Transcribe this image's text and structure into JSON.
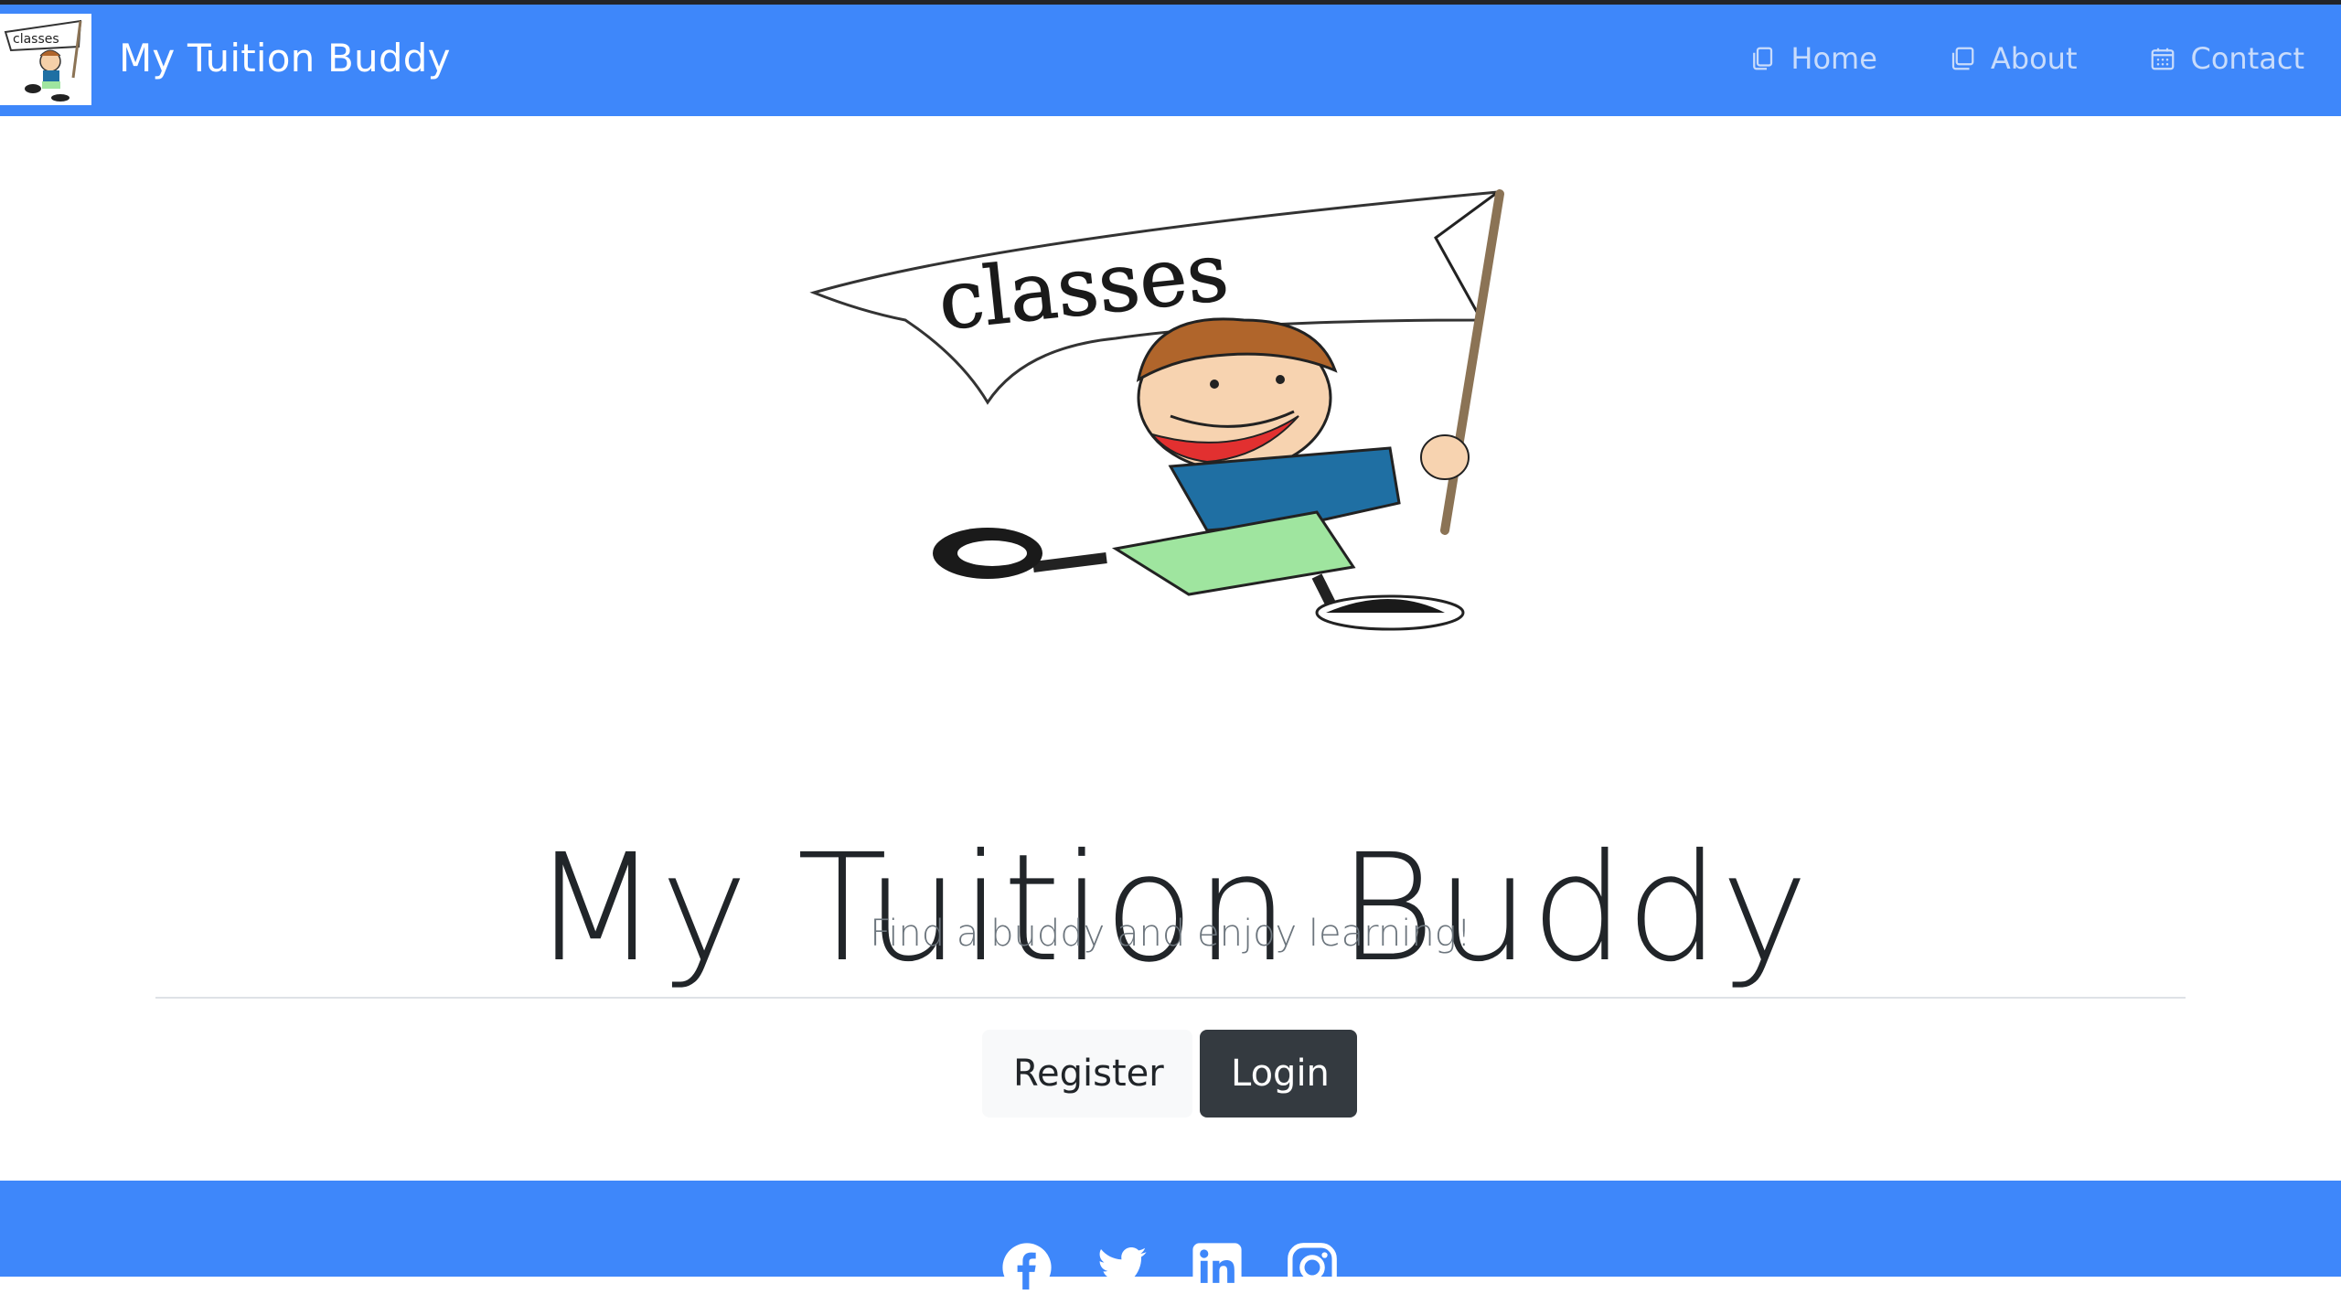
{
  "colors": {
    "primary": "#3e87fa",
    "nav_link": "#c9dcfb",
    "title": "#212529",
    "subtitle": "#6c757d",
    "light_button": "#f8f9fa",
    "dark_button": "#343a40"
  },
  "navbar": {
    "logo_icon": "classes-boy-logo",
    "brand": "My Tuition Buddy",
    "links": [
      {
        "label": "Home",
        "icon": "copy-icon"
      },
      {
        "label": "About",
        "icon": "window-icon"
      },
      {
        "label": "Contact",
        "icon": "calendar-icon"
      }
    ]
  },
  "hero": {
    "image_icon": "boy-with-classes-flag",
    "image_flag_text": "classes",
    "title": "My Tuition Buddy",
    "subtitle": "Find a buddy and enjoy learning!",
    "buttons": {
      "register": "Register",
      "login": "Login"
    }
  },
  "footer": {
    "social": [
      "facebook-icon",
      "twitter-icon",
      "linkedin-icon",
      "instagram-icon"
    ]
  }
}
